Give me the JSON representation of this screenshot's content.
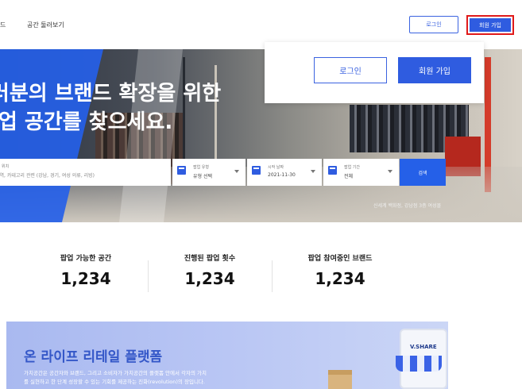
{
  "nav": {
    "truncated_link": "드",
    "browse_link": "공간 둘러보기",
    "login_label": "로그인",
    "signup_label": "회원 가입"
  },
  "hero": {
    "title_line1": "여러분의 브랜드 확장을 위한",
    "title_line2": "팝업 공간를 찾으세요.",
    "credit": "신세계 백화점, 강남점 3층 여성몰"
  },
  "search": {
    "location_small": "위치",
    "location_placeholder": "지역, 카테고리 관련 (강남, 경기, 여성 의류, 리빙)",
    "type_small": "팝업 유형",
    "type_value": "유형 선택",
    "start_small": "시작 날짜",
    "start_value": "2021-11-30",
    "period_small": "팝업 기간",
    "period_value": "전체",
    "button_label": "검색"
  },
  "popup": {
    "login_label": "로그인",
    "signup_label": "회원 가입"
  },
  "stats": [
    {
      "label": "팝업 가능한 공간",
      "value": "1,234"
    },
    {
      "label": "진행된 팝업 횟수",
      "value": "1,234"
    },
    {
      "label": "팝업 참여중인 브랜드",
      "value": "1,234"
    }
  ],
  "banner": {
    "title": "온 라이프 리테일 플랫폼",
    "desc_line1": "가치공간은 공간자와 브랜드, 그리고 소비자가 가치공간의 플랫폼 안에서 각자의 가치",
    "desc_line2": "를 실현하고 한 단계 성장할 수 있는 기회를 제공하는 진화(revolution)의 장입니다.",
    "phone_logo": "V.SHARE"
  },
  "colors": {
    "brand_blue": "#2f5ce0",
    "highlight_red": "#e01a1a"
  }
}
